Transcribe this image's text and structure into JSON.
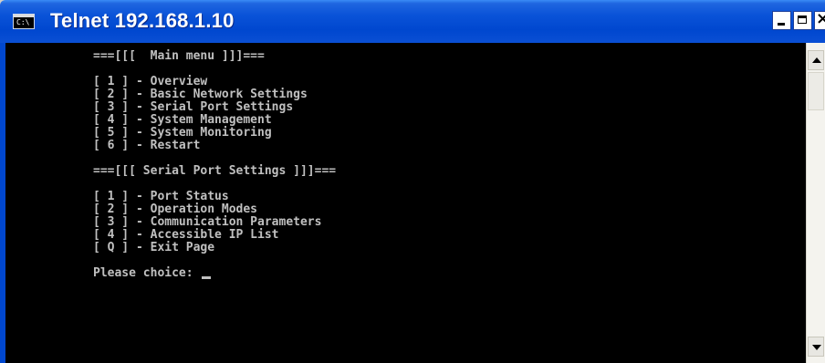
{
  "window": {
    "title": "Telnet 192.168.1.10",
    "icon_label": "C:\\",
    "icon": "console-icon",
    "controls": [
      "minimize-icon",
      "maximize-icon",
      "close-icon"
    ]
  },
  "terminal": {
    "lines": [
      "===[[[  Main menu ]]]===",
      "",
      "[ 1 ] - Overview",
      "[ 2 ] - Basic Network Settings",
      "[ 3 ] - Serial Port Settings",
      "[ 4 ] - System Management",
      "[ 5 ] - System Monitoring",
      "[ 6 ] - Restart",
      "",
      "===[[[ Serial Port Settings ]]]===",
      "",
      "[ 1 ] - Port Status",
      "[ 2 ] - Operation Modes",
      "[ 3 ] - Communication Parameters",
      "[ 4 ] - Accessible IP List",
      "[ Q ] - Exit Page",
      ""
    ],
    "prompt": "Please choice: "
  },
  "colors": {
    "titlebar": "#0047cf",
    "console_bg": "#000000",
    "console_text": "#c0c0c0"
  }
}
